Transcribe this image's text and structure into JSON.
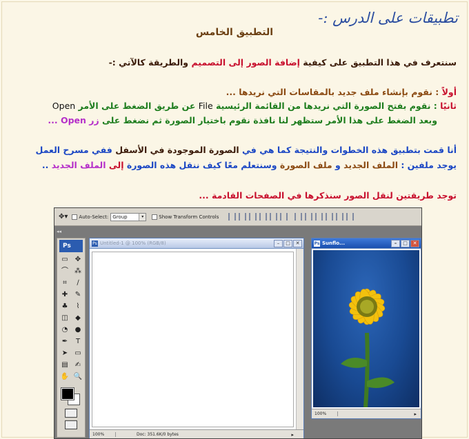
{
  "lesson": {
    "heading": "تطبيقات على الدرس :-",
    "subtitle": "التطبيق الخامس",
    "intro": {
      "p1": "سنتعرف في هذا التطبيق على كيفية ",
      "p2": "إضافة الصور إلى التصميم",
      "p3": " والطريقة كالآتي :-"
    },
    "step1": {
      "label": "أولاً",
      "text": " : نقوم بإنشاء ملف جديد بالمقاسات التي نريدها ..."
    },
    "step2": {
      "label": "ثانيًا",
      "p1": " : نقوم بفتح الصورة التي نريدها من القائمة الرئيسية ",
      "p2": "File",
      "p3": " عن طريق الضغط على الأمر ",
      "p4": "Open"
    },
    "step2b": {
      "p1": "وبعد الضغط على هذا الأمر ستظهر لنا نافذة نقوم باختيار الصورة ثم نضغط على ",
      "p2": "زر Open",
      "p3": " ..."
    },
    "result1": {
      "p1": "أنا قمت بتطبيق هذه الخطوات والنتيجة كما هي في ",
      "p2": "الصورة الموجودة في الأسفل",
      "p3": " ففي مسرح العمل"
    },
    "result2": {
      "p1": "يوجد ملفين : ",
      "p2": "الملف الجديد",
      "p3": " و ",
      "p4": "ملف الصورة",
      "p5": " وسنتعلم معًا كيف ننقل هذه الصورة ",
      "p6": "إلى",
      "p7": " ",
      "p8": "الملف الجديد",
      "p9": " .."
    },
    "closing": "توجد طريقتين لنقل الصور سنذكرها في الصفحات القادمة ..."
  },
  "colors": {
    "red": "#c8102e",
    "blue": "#1b47c4",
    "green": "#1e7d1e",
    "purple": "#b52fc9",
    "brown": "#8b4a12",
    "photo_bg": "#194a93",
    "sunflower": "#f2c10e"
  },
  "photoshop": {
    "options_bar": {
      "auto_select_label": "Auto-Select:",
      "auto_select_value": "Group",
      "transform_label": "Show Transform Controls"
    },
    "palette_logo": "Ps",
    "tools": [
      "▭",
      "✥",
      "⌒",
      "⁂",
      "⌗",
      "∕",
      "✚",
      "✎",
      "♣",
      "⌇",
      "◫",
      "◆",
      "◔",
      "●",
      "✒",
      "T",
      "➤",
      "▭",
      "▤",
      "✍",
      "✋",
      "🔍"
    ],
    "documents": [
      {
        "title": "Untitled-1 @ 100% (RGB/8)",
        "zoom": "100%",
        "doc_info": "Doc: 351.6K/0 bytes"
      },
      {
        "title": "Sunflo...",
        "zoom": "100%"
      }
    ]
  }
}
